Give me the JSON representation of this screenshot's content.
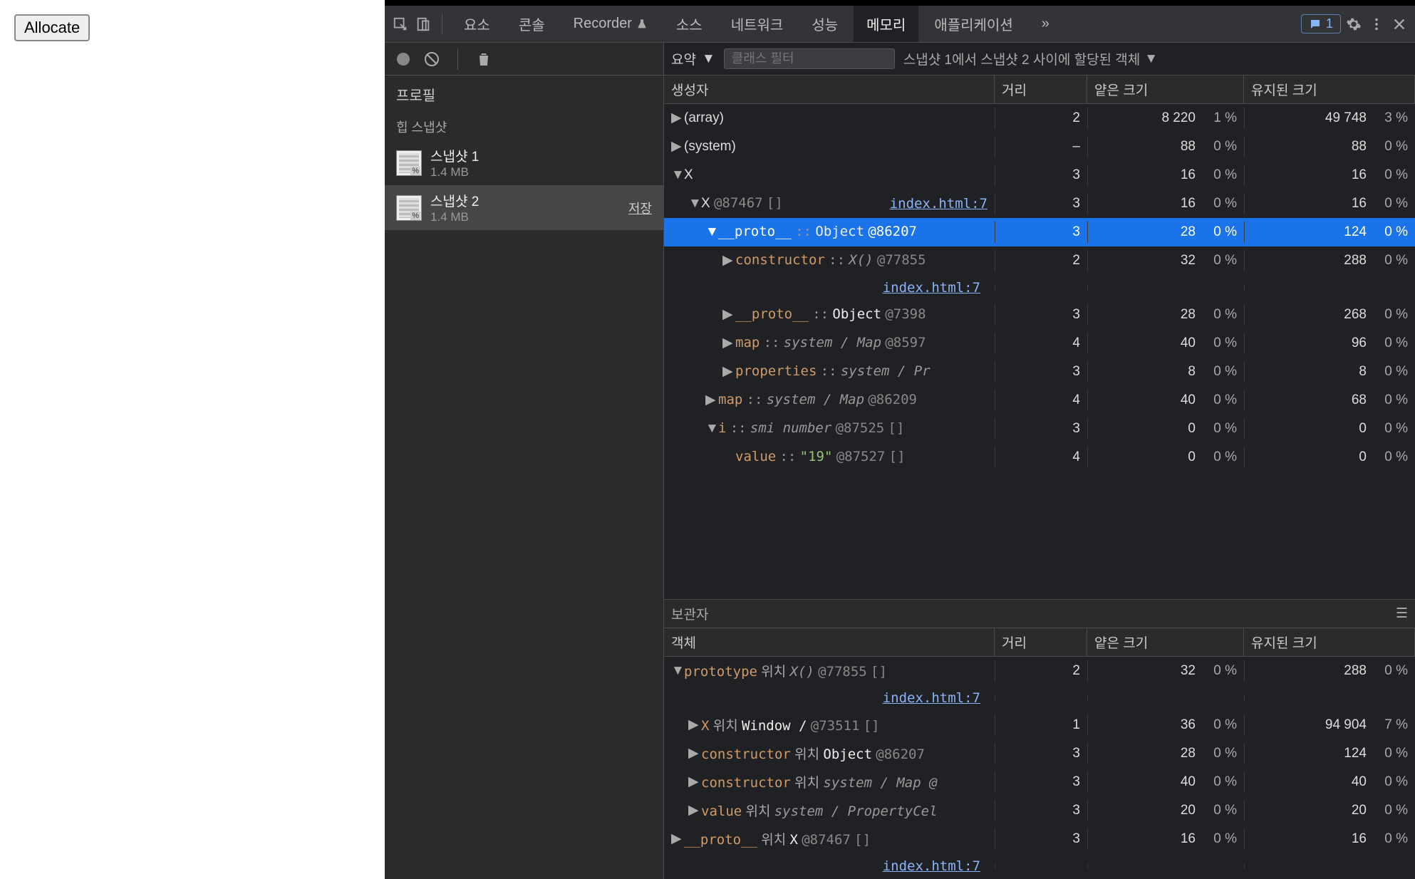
{
  "page": {
    "allocate_button": "Allocate"
  },
  "tabs": {
    "elements": "요소",
    "console": "콘솔",
    "recorder": "Recorder",
    "sources": "소스",
    "network": "네트워크",
    "performance": "성능",
    "memory": "메모리",
    "application": "애플리케이션",
    "more": "»",
    "issues_count": "1"
  },
  "profile": {
    "header": "프로필",
    "heap_snapshots": "힙 스냅샷",
    "save": "저장",
    "snapshots": [
      {
        "title": "스냅샷 1",
        "size": "1.4 MB"
      },
      {
        "title": "스냅샷 2",
        "size": "1.4 MB"
      }
    ]
  },
  "toolbar": {
    "summary": "요약",
    "class_filter_placeholder": "클래스 필터",
    "alloc_filter": "스냅샷 1에서 스냅샷 2 사이에 할당된 객체"
  },
  "columns": {
    "constructor": "생성자",
    "distance": "거리",
    "shallow": "얕은 크기",
    "retained": "유지된 크기",
    "object": "객체"
  },
  "retainers_label": "보관자",
  "rows": [
    {
      "indent": 0,
      "toggle": "▶",
      "html": "(array)",
      "dist": "2",
      "shallow": "8 220",
      "shallow_pct": "1 %",
      "retained": "49 748",
      "retained_pct": "3 %"
    },
    {
      "indent": 0,
      "toggle": "▶",
      "html": "(system)",
      "dist": "–",
      "shallow": "88",
      "shallow_pct": "0 %",
      "retained": "88",
      "retained_pct": "0 %"
    },
    {
      "indent": 0,
      "toggle": "▼",
      "html": "X",
      "dist": "3",
      "shallow": "16",
      "shallow_pct": "0 %",
      "retained": "16",
      "retained_pct": "0 %"
    },
    {
      "indent": 1,
      "toggle": "▼",
      "html": "X <span class='mono-id'>@87467</span> <span class='mono-id'>[]</span>",
      "link": "index.html:7",
      "dist": "3",
      "shallow": "16",
      "shallow_pct": "0 %",
      "retained": "16",
      "retained_pct": "0 %"
    },
    {
      "indent": 2,
      "toggle": "▼",
      "selected": true,
      "html": "<span class='mono-prop'>__proto__</span> <span class='mono-sep'>::</span> <span class='mono-typew'>Object</span> <span class='mono-id'>@86207</span>",
      "dist": "3",
      "shallow": "28",
      "shallow_pct": "0 %",
      "retained": "124",
      "retained_pct": "0 %"
    },
    {
      "indent": 3,
      "toggle": "▶",
      "html": "<span class='mono-prop'>constructor</span> <span class='mono-sep'>::</span> <span class='mono-type'>X()</span> <span class='mono-id'>@77855</span>",
      "link_below": "index.html:7",
      "dist": "2",
      "shallow": "32",
      "shallow_pct": "0 %",
      "retained": "288",
      "retained_pct": "0 %"
    },
    {
      "indent": 3,
      "toggle": "▶",
      "html": "<span class='mono-prop'>__proto__</span> <span class='mono-sep'>::</span> <span class='mono-typew'>Object</span> <span class='mono-id'>@7398</span>",
      "dist": "3",
      "shallow": "28",
      "shallow_pct": "0 %",
      "retained": "268",
      "retained_pct": "0 %"
    },
    {
      "indent": 3,
      "toggle": "▶",
      "html": "<span class='mono-prop'>map</span> <span class='mono-sep'>::</span> <span class='mono-type'>system / Map</span> <span class='mono-id'>@8597</span>",
      "dist": "4",
      "shallow": "40",
      "shallow_pct": "0 %",
      "retained": "96",
      "retained_pct": "0 %"
    },
    {
      "indent": 3,
      "toggle": "▶",
      "html": "<span class='mono-prop'>properties</span> <span class='mono-sep'>::</span> <span class='mono-type'>system / Pr</span>",
      "dist": "3",
      "shallow": "8",
      "shallow_pct": "0 %",
      "retained": "8",
      "retained_pct": "0 %"
    },
    {
      "indent": 2,
      "toggle": "▶",
      "html": "<span class='mono-prop'>map</span> <span class='mono-sep'>::</span> <span class='mono-type'>system / Map</span> <span class='mono-id'>@86209</span>",
      "dist": "4",
      "shallow": "40",
      "shallow_pct": "0 %",
      "retained": "68",
      "retained_pct": "0 %"
    },
    {
      "indent": 2,
      "toggle": "▼",
      "html": "<span class='mono-prop'>i</span> <span class='mono-sep'>::</span> <span class='mono-type'>smi number</span> <span class='mono-id'>@87525</span> <span class='mono-id'>[]</span>",
      "dist": "3",
      "shallow": "0",
      "shallow_pct": "0 %",
      "retained": "0",
      "retained_pct": "0 %"
    },
    {
      "indent": 3,
      "toggle": "",
      "html": "<span class='mono-prop'>value</span> <span class='mono-sep'>::</span> <span class='mono-str'>\"19\"</span> <span class='mono-id'>@87527</span> <span class='mono-id'>[]</span>",
      "dist": "4",
      "shallow": "0",
      "shallow_pct": "0 %",
      "retained": "0",
      "retained_pct": "0 %"
    }
  ],
  "retainers": [
    {
      "indent": 0,
      "toggle": "▼",
      "html": "<span class='mono-prop'>prototype</span> <span style='color:#aaa'>위치</span> <span class='mono-type'>X()</span> <span class='mono-id'>@77855</span> <span class='mono-id'>[]</span>",
      "link_below": "index.html:7",
      "dist": "2",
      "shallow": "32",
      "shallow_pct": "0 %",
      "retained": "288",
      "retained_pct": "0 %"
    },
    {
      "indent": 1,
      "toggle": "▶",
      "html": "<span class='mono-prop'>X</span> <span style='color:#aaa'>위치</span> <span class='mono-typew'>Window /</span> <span class='mono-id'>@73511</span> <span class='mono-id'>[]</span>",
      "dist": "1",
      "shallow": "36",
      "shallow_pct": "0 %",
      "retained": "94 904",
      "retained_pct": "7 %"
    },
    {
      "indent": 1,
      "toggle": "▶",
      "html": "<span class='mono-prop'>constructor</span> <span style='color:#aaa'>위치</span> <span class='mono-typew'>Object</span> <span class='mono-id'>@86207</span>",
      "dist": "3",
      "shallow": "28",
      "shallow_pct": "0 %",
      "retained": "124",
      "retained_pct": "0 %"
    },
    {
      "indent": 1,
      "toggle": "▶",
      "html": "<span class='mono-prop'>constructor</span> <span style='color:#aaa'>위치</span> <span class='mono-type'>system / Map @</span>",
      "dist": "3",
      "shallow": "40",
      "shallow_pct": "0 %",
      "retained": "40",
      "retained_pct": "0 %"
    },
    {
      "indent": 1,
      "toggle": "▶",
      "html": "<span class='mono-prop'>value</span> <span style='color:#aaa'>위치</span> <span class='mono-type'>system / PropertyCel</span>",
      "dist": "3",
      "shallow": "20",
      "shallow_pct": "0 %",
      "retained": "20",
      "retained_pct": "0 %"
    },
    {
      "indent": 0,
      "toggle": "▶",
      "html": "<span class='mono-prop'>__proto__</span> <span style='color:#aaa'>위치</span> <span class='mono-typew'>X</span> <span class='mono-id'>@87467</span> <span class='mono-id'>[]</span>",
      "link_below": "index.html:7",
      "dist": "3",
      "shallow": "16",
      "shallow_pct": "0 %",
      "retained": "16",
      "retained_pct": "0 %"
    }
  ]
}
